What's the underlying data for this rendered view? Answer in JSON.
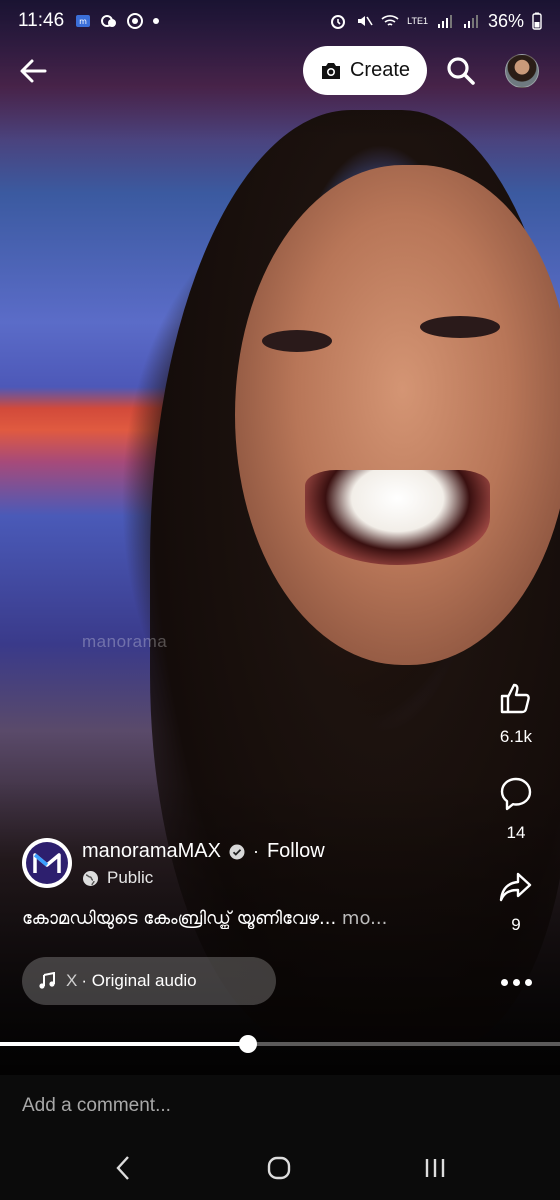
{
  "status_bar": {
    "time": "11:46",
    "battery": "36%",
    "network": "LTE1"
  },
  "top_bar": {
    "create_label": "Create"
  },
  "video": {
    "watermark": "manorama"
  },
  "side_actions": {
    "likes": "6.1k",
    "comments": "14",
    "shares": "9"
  },
  "poster": {
    "name": "manoramaMAX",
    "separator": "·",
    "follow_label": "Follow",
    "privacy": "Public"
  },
  "caption": {
    "text": "കോമഡിയുടെ കേംബ്രിഡ്ജ് യൂണിവേഴ...",
    "more_label": "mo..."
  },
  "audio": {
    "artist": "X",
    "label": "· Original audio"
  },
  "playback": {
    "progress": 0.443
  },
  "comment": {
    "placeholder": "Add a comment..."
  }
}
